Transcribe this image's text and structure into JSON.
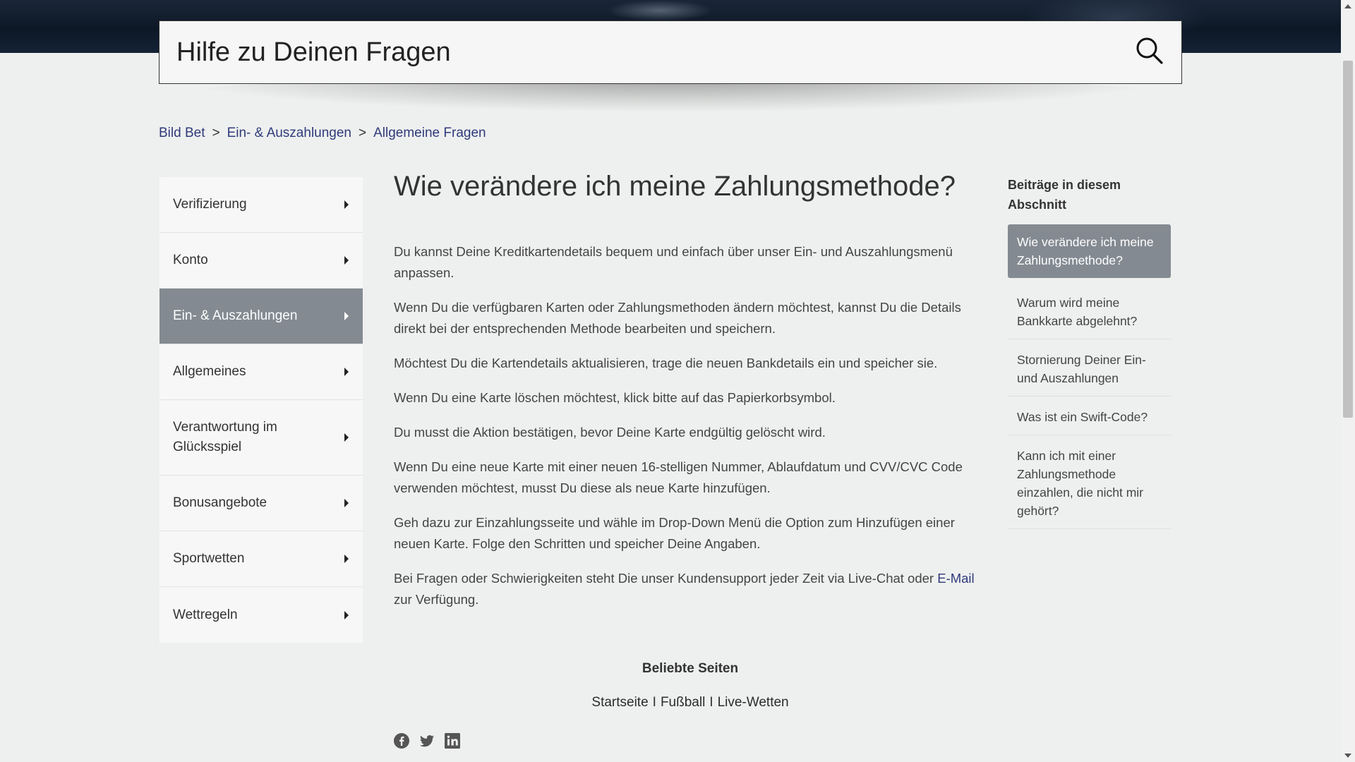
{
  "search": {
    "placeholder": "Hilfe zu Deinen Fragen",
    "icon": "search-icon"
  },
  "breadcrumb": [
    "Bild Bet",
    "Ein- & Auszahlungen",
    "Allgemeine Fragen"
  ],
  "breadcrumb_separator": ">",
  "sidebar": {
    "items": [
      {
        "label": "Verifizierung"
      },
      {
        "label": "Konto"
      },
      {
        "label": "Ein- & Auszahlungen",
        "active": true
      },
      {
        "label": "Allgemeines"
      },
      {
        "label": "Verantwortung im Glücksspiel"
      },
      {
        "label": "Bonusangebote"
      },
      {
        "label": "Sportwetten"
      },
      {
        "label": "Wettregeln"
      }
    ]
  },
  "article": {
    "title": "Wie verändere ich meine Zahlungsmethode?",
    "paragraphs": [
      "Du kannst Deine Kreditkartendetails bequem und einfach über unser Ein- und Auszahlungsmenü anpassen.",
      "Wenn Du die verfügbaren Karten oder Zahlungsmethoden ändern möchtest, kannst Du die Details direkt bei der entsprechenden Methode bearbeiten und speichern.",
      "Möchtest Du die Kartendetails aktualisieren, trage die neuen Bankdetails ein und speicher sie.",
      "Wenn Du eine Karte löschen möchtest, klick bitte auf das Papierkorbsymbol.",
      "Du musst die Aktion bestätigen, bevor Deine Karte endgültig gelöscht wird.",
      "Wenn Du eine neue Karte mit einer neuen 16-stelligen Nummer, Ablaufdatum und CVV/CVC Code verwenden möchtest, musst Du diese als neue Karte hinzufügen.",
      "Geh dazu zur Einzahlungsseite und wähle im Drop-Down Menü die Option zum Hinzufügen einer neuen Karte. Folge den Schritten und speicher Deine Angaben."
    ],
    "last_paragraph_text": "Bei Fragen oder Schwierigkeiten steht Die unser Kundensupport jeder Zeit via Live-Chat oder ",
    "last_paragraph_link": "E-Mail",
    "last_paragraph_tail": "zur Verfügung."
  },
  "related": {
    "heading": "Beiträge in diesem Abschnitt",
    "items": [
      {
        "label": "Wie verändere ich meine Zahlungsmethode?",
        "active": true
      },
      {
        "label": "Warum wird meine Bankkarte abgelehnt?"
      },
      {
        "label": "Stornierung Deiner Ein- und Auszahlungen"
      },
      {
        "label": "Was ist ein Swift-Code?"
      },
      {
        "label": "Kann ich mit einer Zahlungsmethode einzahlen, die nicht mir gehört?"
      }
    ]
  },
  "footer": {
    "title": "Beliebte Seiten",
    "links": [
      "Startseite",
      "Fußball",
      "Live-Wetten"
    ],
    "link_separator": "I",
    "social": [
      "facebook-icon",
      "twitter-icon",
      "linkedin-icon"
    ]
  },
  "colors": {
    "accent_link": "#2f3a7a",
    "active_bg": "#838a91",
    "page_bg": "#eef0ef"
  }
}
